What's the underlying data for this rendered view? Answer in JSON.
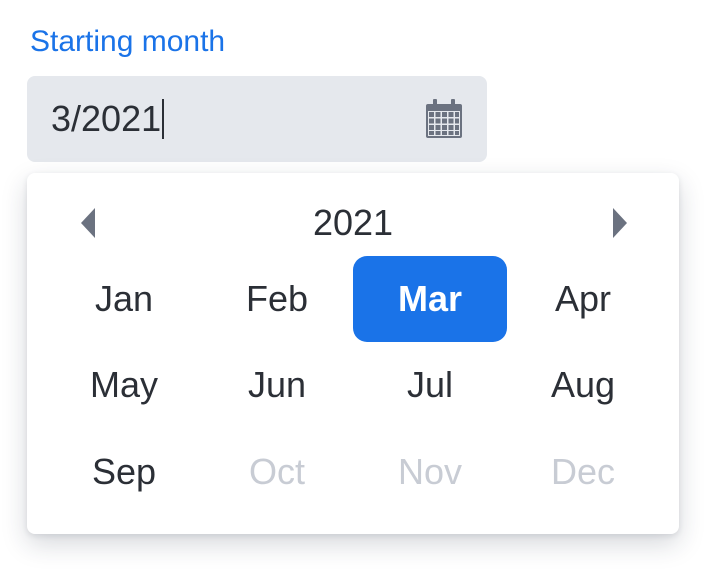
{
  "field": {
    "label": "Starting month",
    "value": "3/2021"
  },
  "icons": {
    "input_icon": "calendar-icon",
    "prev": "caret-left-icon",
    "next": "caret-right-icon"
  },
  "picker": {
    "year": "2021",
    "months": [
      {
        "label": "Jan",
        "state": "normal"
      },
      {
        "label": "Feb",
        "state": "normal"
      },
      {
        "label": "Mar",
        "state": "selected"
      },
      {
        "label": "Apr",
        "state": "normal"
      },
      {
        "label": "May",
        "state": "normal"
      },
      {
        "label": "Jun",
        "state": "normal"
      },
      {
        "label": "Jul",
        "state": "normal"
      },
      {
        "label": "Aug",
        "state": "normal"
      },
      {
        "label": "Sep",
        "state": "normal"
      },
      {
        "label": "Oct",
        "state": "disabled"
      },
      {
        "label": "Nov",
        "state": "disabled"
      },
      {
        "label": "Dec",
        "state": "disabled"
      }
    ]
  },
  "colors": {
    "accent": "#1a73e8",
    "input_background": "#e5e8ed",
    "text": "#2b2f36",
    "disabled_text": "#c8ccd4",
    "icon": "#6b7280"
  }
}
